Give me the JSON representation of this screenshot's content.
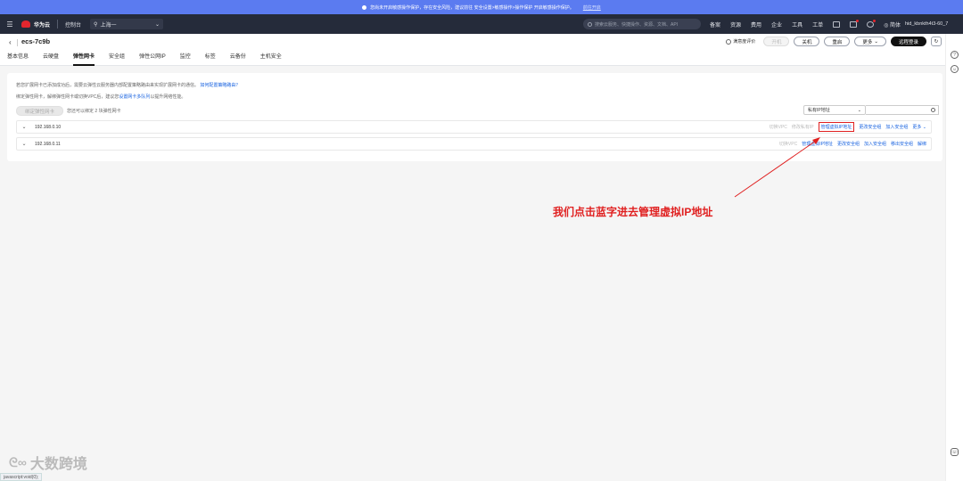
{
  "notice": {
    "text": "您尚未开启敏感操作保护，存在安全风险，建议前往 安全设置>敏感操作>操作保护 开启敏感操作保护。",
    "link": "前往开启"
  },
  "topbar": {
    "brand": "华为云",
    "console": "控制台",
    "region": "上海一",
    "search_placeholder": "搜索云服务、快捷操作、资源、文档、API",
    "items": [
      "备案",
      "资源",
      "费用",
      "企业",
      "工具",
      "工单"
    ],
    "intl": "简体",
    "user": "hid_kbnkth4t3-60_7"
  },
  "header": {
    "title": "ecs-7c9b",
    "feedback": "满意度评价",
    "buttons": {
      "start": "开机",
      "stop": "关机",
      "restart": "重启",
      "more": "更多",
      "remote": "远程登录"
    },
    "tabs": [
      "基本信息",
      "云硬盘",
      "弹性网卡",
      "安全组",
      "弹性公网IP",
      "监控",
      "标签",
      "云备份",
      "主机安全"
    ],
    "active_tab": 2
  },
  "panel": {
    "info_line1": "若您扩展网卡已添加成功后，需要云弹性云服务器内部配置策略路由来实现扩展网卡的通信。",
    "info_link1": "如何配置策略路由？",
    "info_line2": "绑定弹性网卡，解绑弹性网卡或切换VPC后，建议您",
    "info_link2": "设置网卡多队列",
    "info_line2_tail": "以提升网络性能。",
    "bind_button": "绑定弹性网卡",
    "bind_hint": "您还可以绑定 2 块弹性网卡",
    "filter_select": "私有IP地址",
    "rows": [
      {
        "ip": "192.168.0.10",
        "ops": [
          {
            "label": "切换VPC",
            "dim": true
          },
          {
            "label": "修改私有IP",
            "dim": true
          },
          {
            "label": "管理虚拟IP地址",
            "highlight": true
          },
          {
            "label": "更改安全组"
          },
          {
            "label": "加入安全组"
          },
          {
            "label": "更多"
          }
        ]
      },
      {
        "ip": "192.168.0.11",
        "ops": [
          {
            "label": "切换VPC",
            "dim": true
          },
          {
            "label": "管理虚拟IP地址"
          },
          {
            "label": "更改安全组"
          },
          {
            "label": "加入安全组"
          },
          {
            "label": "移出安全组"
          },
          {
            "label": "解绑"
          }
        ]
      }
    ]
  },
  "annotation": "我们点击蓝字进去管理虚拟IP地址",
  "watermark": "大数跨境",
  "statusbar": "javascript:void(0);"
}
